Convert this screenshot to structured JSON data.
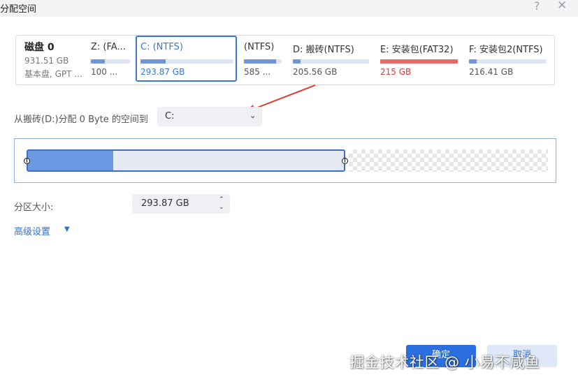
{
  "dialog": {
    "title": "分配空间",
    "help_icon": "?",
    "close_icon": "✕"
  },
  "disk": {
    "name": "磁盘 0",
    "size": "931.51 GB",
    "type": "基本盘, GPT ..."
  },
  "partitions": [
    {
      "label": "Z: (FA...",
      "size": "100 ...",
      "fill": 0.35,
      "state": "normal"
    },
    {
      "label": "C: (NTFS)",
      "size": "293.87 GB",
      "fill": 0.27,
      "state": "selected"
    },
    {
      "label": "(NTFS)",
      "size": "585 ...",
      "fill": 0.85,
      "state": "normal"
    },
    {
      "label": "D: 搬砖(NTFS)",
      "size": "205.56 GB",
      "fill": 0.1,
      "state": "normal"
    },
    {
      "label": "E: 安装包(FAT32)",
      "size": "215 GB",
      "fill": 1.0,
      "state": "warning"
    },
    {
      "label": "F: 安装包2(NTFS)",
      "size": "216.41 GB",
      "fill": 0.1,
      "state": "normal"
    }
  ],
  "allocate": {
    "label": "从搬砖(D:)分配 0 Byte 的空间到",
    "selected": "C:"
  },
  "resize": {
    "used_fraction": 0.27
  },
  "size_field": {
    "label": "分区大小:",
    "value": "293.87 GB"
  },
  "advanced": {
    "label": "高级设置"
  },
  "buttons": {
    "ok": "确定",
    "cancel": "取消"
  },
  "watermark": "掘金技术社区 @ 小易不咸鱼",
  "colors": {
    "accent": "#2c6fe0",
    "bar_fill": "#6f95d6",
    "warning": "#e8696a"
  }
}
